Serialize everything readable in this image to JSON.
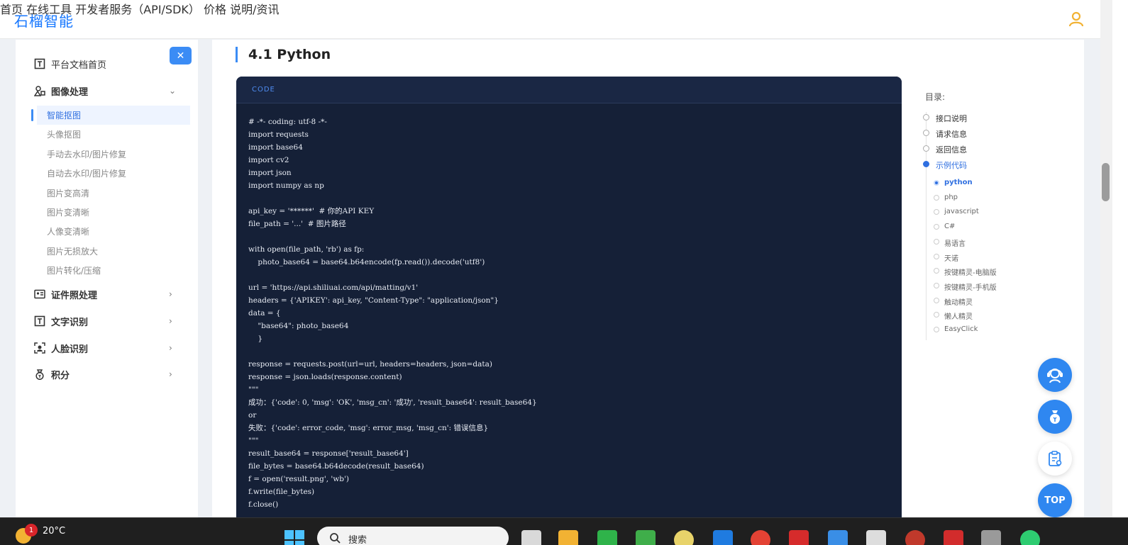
{
  "header": {
    "brand": "石榴智能",
    "nav": [
      "首页",
      "在线工具",
      "开发者服务（API/SDK）",
      "价格",
      "说明/资讯"
    ]
  },
  "sidebar": {
    "close_label": "✕",
    "home": "平台文档首页",
    "group_image": "图像处理",
    "sub_items": [
      "智能抠图",
      "头像抠图",
      "手动去水印/图片修复",
      "自动去水印/图片修复",
      "图片变高清",
      "图片变清晰",
      "人像变清晰",
      "图片无损放大",
      "图片转化/压缩"
    ],
    "active_sub_index": 0,
    "groups": [
      "证件照处理",
      "文字识别",
      "人脸识别",
      "积分"
    ]
  },
  "main": {
    "section_title": "4.1 Python",
    "code_label": "CODE",
    "code_lines": [
      "# -*- coding: utf-8 -*-",
      "import requests",
      "import base64",
      "import cv2",
      "import json",
      "import numpy as np",
      "",
      "api_key = '******'  # 你的API KEY",
      "file_path = '...'  # 图片路径",
      "",
      "with open(file_path, 'rb') as fp:",
      "    photo_base64 = base64.b64encode(fp.read()).decode('utf8')",
      "",
      "url = 'https://api.shiliuai.com/api/matting/v1'",
      "headers = {'APIKEY': api_key, \"Content-Type\": \"application/json\"}",
      "data = {",
      "    \"base64\": photo_base64",
      "    }",
      "",
      "response = requests.post(url=url, headers=headers, json=data)",
      "response = json.loads(response.content)",
      "\"\"\"",
      "成功：{'code': 0, 'msg': 'OK', 'msg_cn': '成功', 'result_base64': result_base64}",
      "or",
      "失败：{'code': error_code, 'msg': error_msg, 'msg_cn': 错误信息}",
      "\"\"\"",
      "result_base64 = response['result_base64']",
      "file_bytes = base64.b64decode(result_base64)",
      "f = open('result.png', 'wb')",
      "f.write(file_bytes)",
      "f.close()"
    ]
  },
  "toc": {
    "title": "目录:",
    "items": [
      "接口说明",
      "请求信息",
      "返回信息",
      "示例代码"
    ],
    "active_item_index": 3,
    "sub_items": [
      "python",
      "php",
      "javascript",
      "C#",
      "易语言",
      "天诺",
      "按键精灵-电脑版",
      "按键精灵-手机版",
      "触动精灵",
      "懒人精灵",
      "EasyClick"
    ],
    "active_sub_index": 0
  },
  "floating": {
    "top_label": "TOP",
    "icons": [
      "customer-service-icon",
      "money-bag-icon",
      "clipboard-icon"
    ]
  },
  "taskbar": {
    "temperature": "20°C",
    "weather_badge": "1",
    "search_placeholder": "搜索"
  },
  "colors": {
    "accent": "#3b8cf5",
    "code_bg": "#152037",
    "brand": "#1677ff"
  }
}
